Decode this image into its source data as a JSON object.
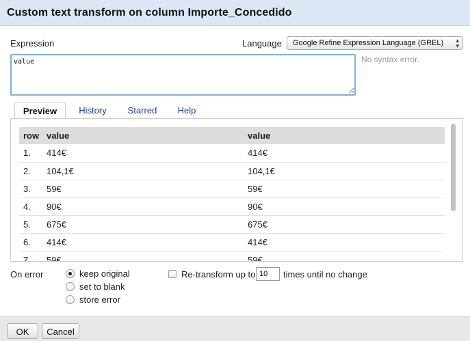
{
  "dialog": {
    "title": "Custom text transform on column Importe_Concedido"
  },
  "expression": {
    "label": "Expression",
    "value": "value",
    "status": "No syntax error."
  },
  "language": {
    "label": "Language",
    "selected": "Google Refine Expression Language (GREL)"
  },
  "tabs": [
    {
      "label": "Preview",
      "active": true
    },
    {
      "label": "History",
      "active": false
    },
    {
      "label": "Starred",
      "active": false
    },
    {
      "label": "Help",
      "active": false
    }
  ],
  "preview": {
    "headers": [
      "row",
      "value",
      "value"
    ],
    "rows": [
      [
        "1.",
        "414€",
        "414€"
      ],
      [
        "2.",
        "104,1€",
        "104,1€"
      ],
      [
        "3.",
        "59€",
        "59€"
      ],
      [
        "4.",
        "90€",
        "90€"
      ],
      [
        "5.",
        "675€",
        "675€"
      ],
      [
        "6.",
        "414€",
        "414€"
      ],
      [
        "7.",
        "59€",
        "59€"
      ]
    ]
  },
  "on_error": {
    "label": "On error",
    "options": [
      {
        "label": "keep original",
        "checked": true
      },
      {
        "label": "set to blank",
        "checked": false
      },
      {
        "label": "store error",
        "checked": false
      }
    ]
  },
  "retransform": {
    "label": "Re-transform up to",
    "value": "10",
    "suffix": "times until no change",
    "checked": false
  },
  "buttons": {
    "ok": "OK",
    "cancel": "Cancel"
  },
  "colors": {
    "header_bg": "#dde6f5",
    "tab_link": "#1a3ea0",
    "input_focus": "#7fb0e0",
    "footer_bg": "#e8e8e8"
  }
}
